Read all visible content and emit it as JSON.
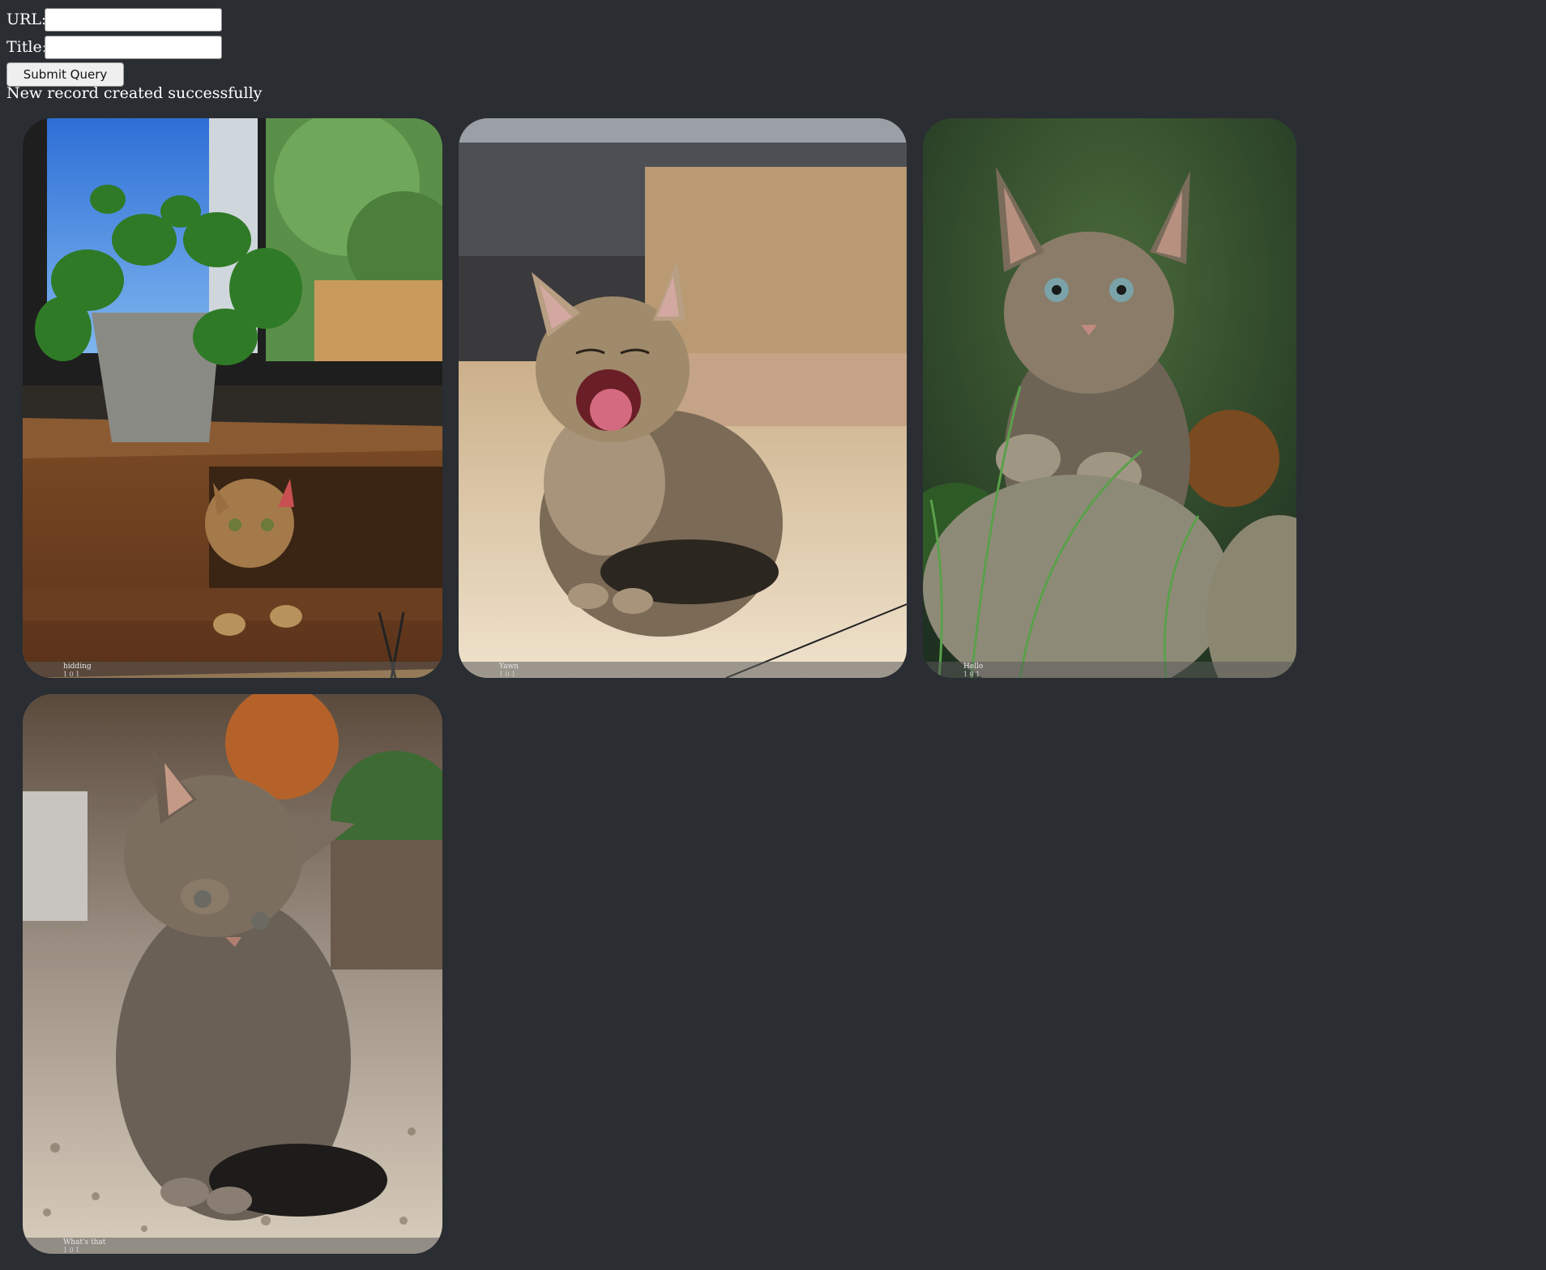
{
  "form": {
    "url_label": "URL:",
    "url_value": "",
    "title_label": "Title:",
    "title_value": "",
    "submit_label": "Submit Query"
  },
  "message": "New record created successfully",
  "cards": [
    {
      "title": "hidding",
      "meta": "1 0 1"
    },
    {
      "title": "Yawn",
      "meta": "1 0 1"
    },
    {
      "title": "Hello",
      "meta": "1 0 1"
    },
    {
      "title": "What's that",
      "meta": "1 0 1"
    }
  ],
  "colors": {
    "page_background": "#2a2d32",
    "text": "#ffffff"
  }
}
